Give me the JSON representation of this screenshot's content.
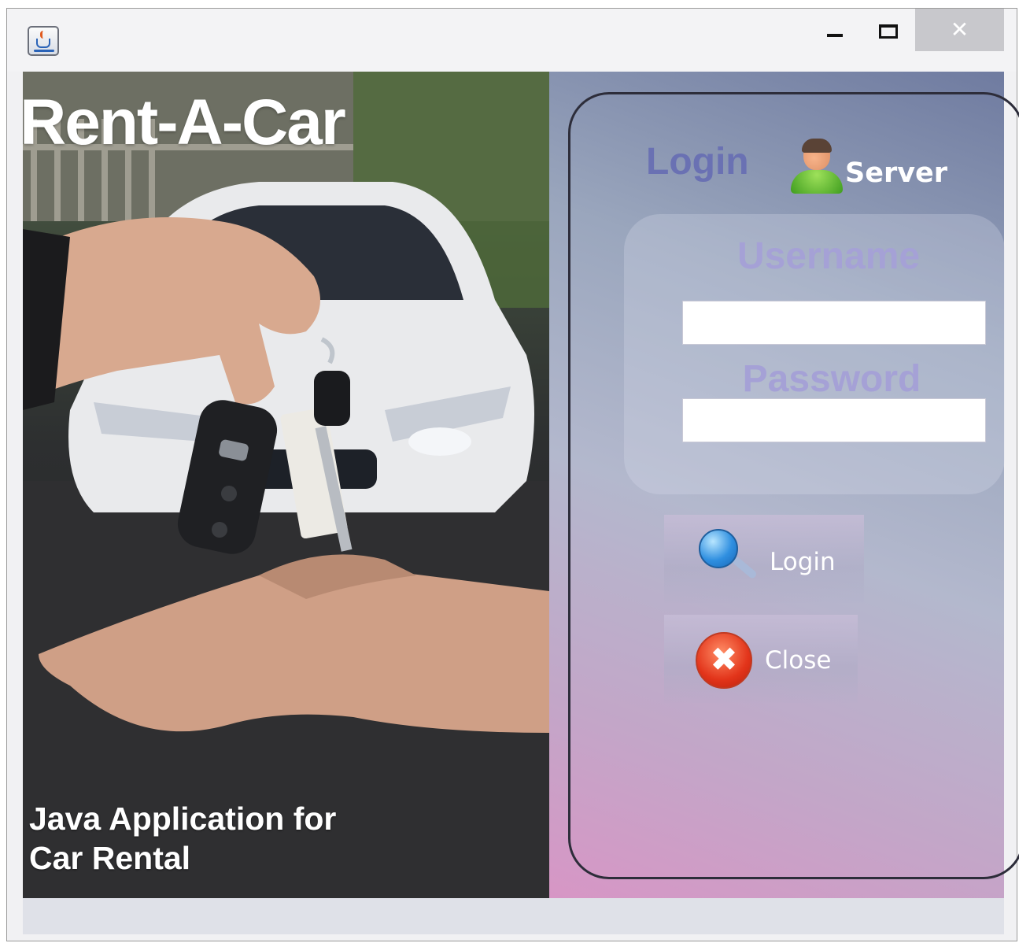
{
  "window": {
    "app_icon": "java-cup-icon",
    "controls": {
      "minimize": "minimize-icon",
      "maximize": "maximize-icon",
      "close_glyph": "✕"
    }
  },
  "banner": {
    "title": "Rent-A-Car",
    "tagline_line1": "Java Application for",
    "tagline_line2": "Car Rental"
  },
  "login_panel": {
    "heading": "Login",
    "user_icon": "user-icon",
    "role_label": "Server",
    "username_label": "Username",
    "username_value": "",
    "password_label": "Password",
    "password_value": "",
    "login_button": {
      "label": "Login",
      "icon": "magnifier-icon"
    },
    "close_button": {
      "label": "Close",
      "icon": "x-circle-icon",
      "glyph": "✖"
    }
  },
  "colors": {
    "heading": "#6a71b3",
    "field_label": "#a5a1d6",
    "panel_top": "#6f7ba0",
    "panel_bottom": "#d796c5",
    "close_icon": "#e2341a"
  }
}
